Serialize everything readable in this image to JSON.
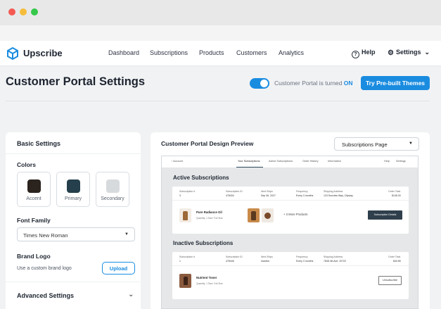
{
  "brand": {
    "name": "Upscribe",
    "color": "#1a8ce0"
  },
  "nav": {
    "links": [
      "Dashboard",
      "Subscriptions",
      "Products",
      "Customers",
      "Analytics"
    ],
    "help": "Help",
    "settings": "Settings"
  },
  "header": {
    "title": "Customer Portal Settings",
    "toggle_text": "Customer Portal is turned ",
    "toggle_state": "ON",
    "themes_button": "Try Pre-built Themes"
  },
  "basic": {
    "title": "Basic Settings",
    "colors_label": "Colors",
    "swatches": [
      {
        "label": "Accent",
        "color": "#2b231e"
      },
      {
        "label": "Primary",
        "color": "#25404c"
      },
      {
        "label": "Secondary",
        "color": "#d7dadd"
      }
    ],
    "font_label": "Font Family",
    "font_value": "Times New Roman",
    "logo_label": "Brand Logo",
    "logo_text": "Use a custom brand logo",
    "upload": "Upload",
    "advanced": "Advanced Settings"
  },
  "preview": {
    "title": "Customer Portal Design Preview",
    "page_select": "Subscriptions Page",
    "nav": {
      "account": "‹ Account",
      "tabs": [
        "Your Subscriptions",
        "Active Subscriptions",
        "Order History",
        "Information"
      ],
      "right": [
        "Help",
        "Settings"
      ]
    },
    "active_title": "Active Subscriptions",
    "inactive_title": "Inactive Subscriptions",
    "active": {
      "headers": [
        "Subscription #",
        "Subscription ID",
        "Next Ships",
        "Frequency",
        "Shipping Address",
        "Order Total"
      ],
      "values": [
        "3",
        "478434",
        "Sep 06, 2027",
        "Every 3 months",
        "123 Sunview Way, Cityway",
        "$145.00"
      ],
      "product": "Pure Radiance Oil",
      "meta": "Quantity: 1     Size: Full Size",
      "more": "+ 3 More Products",
      "button": "Subscription Details"
    },
    "inactive": {
      "headers": [
        "Subscription #",
        "Subscription ID",
        "Next Ships",
        "Frequency",
        "Shipping Address",
        "Order Total"
      ],
      "values": [
        "1",
        "478446",
        "Inactive",
        "Every 3 months",
        "7848 4th Ave. 20722",
        "$40.85"
      ],
      "product": "Nutrient Toner",
      "meta": "Quantity: 1     Size: Full Size",
      "button": "Unsubscribe"
    }
  }
}
